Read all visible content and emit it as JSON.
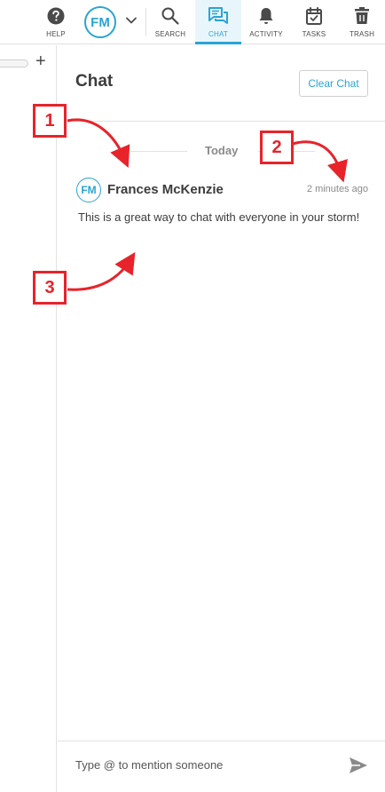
{
  "toolbar": {
    "help_label": "HELP",
    "user_initials": "FM",
    "search_label": "SEARCH",
    "chat_label": "CHAT",
    "activity_label": "ACTIVITY",
    "tasks_label": "TASKS",
    "trash_label": "TRASH",
    "active_tab": "chat"
  },
  "chat": {
    "title": "Chat",
    "clear_label": "Clear Chat",
    "date_separator": "Today",
    "messages": [
      {
        "initials": "FM",
        "author": "Frances McKenzie",
        "time": "2 minutes ago",
        "text": "This is a great way to chat with everyone in your storm!"
      }
    ],
    "composer_placeholder": "Type @ to mention someone"
  },
  "callouts": [
    "1",
    "2",
    "3"
  ],
  "colors": {
    "accent": "#2aa4d4",
    "callout": "#e8232a",
    "text": "#3c3c3c",
    "muted": "#8a8a8a"
  }
}
